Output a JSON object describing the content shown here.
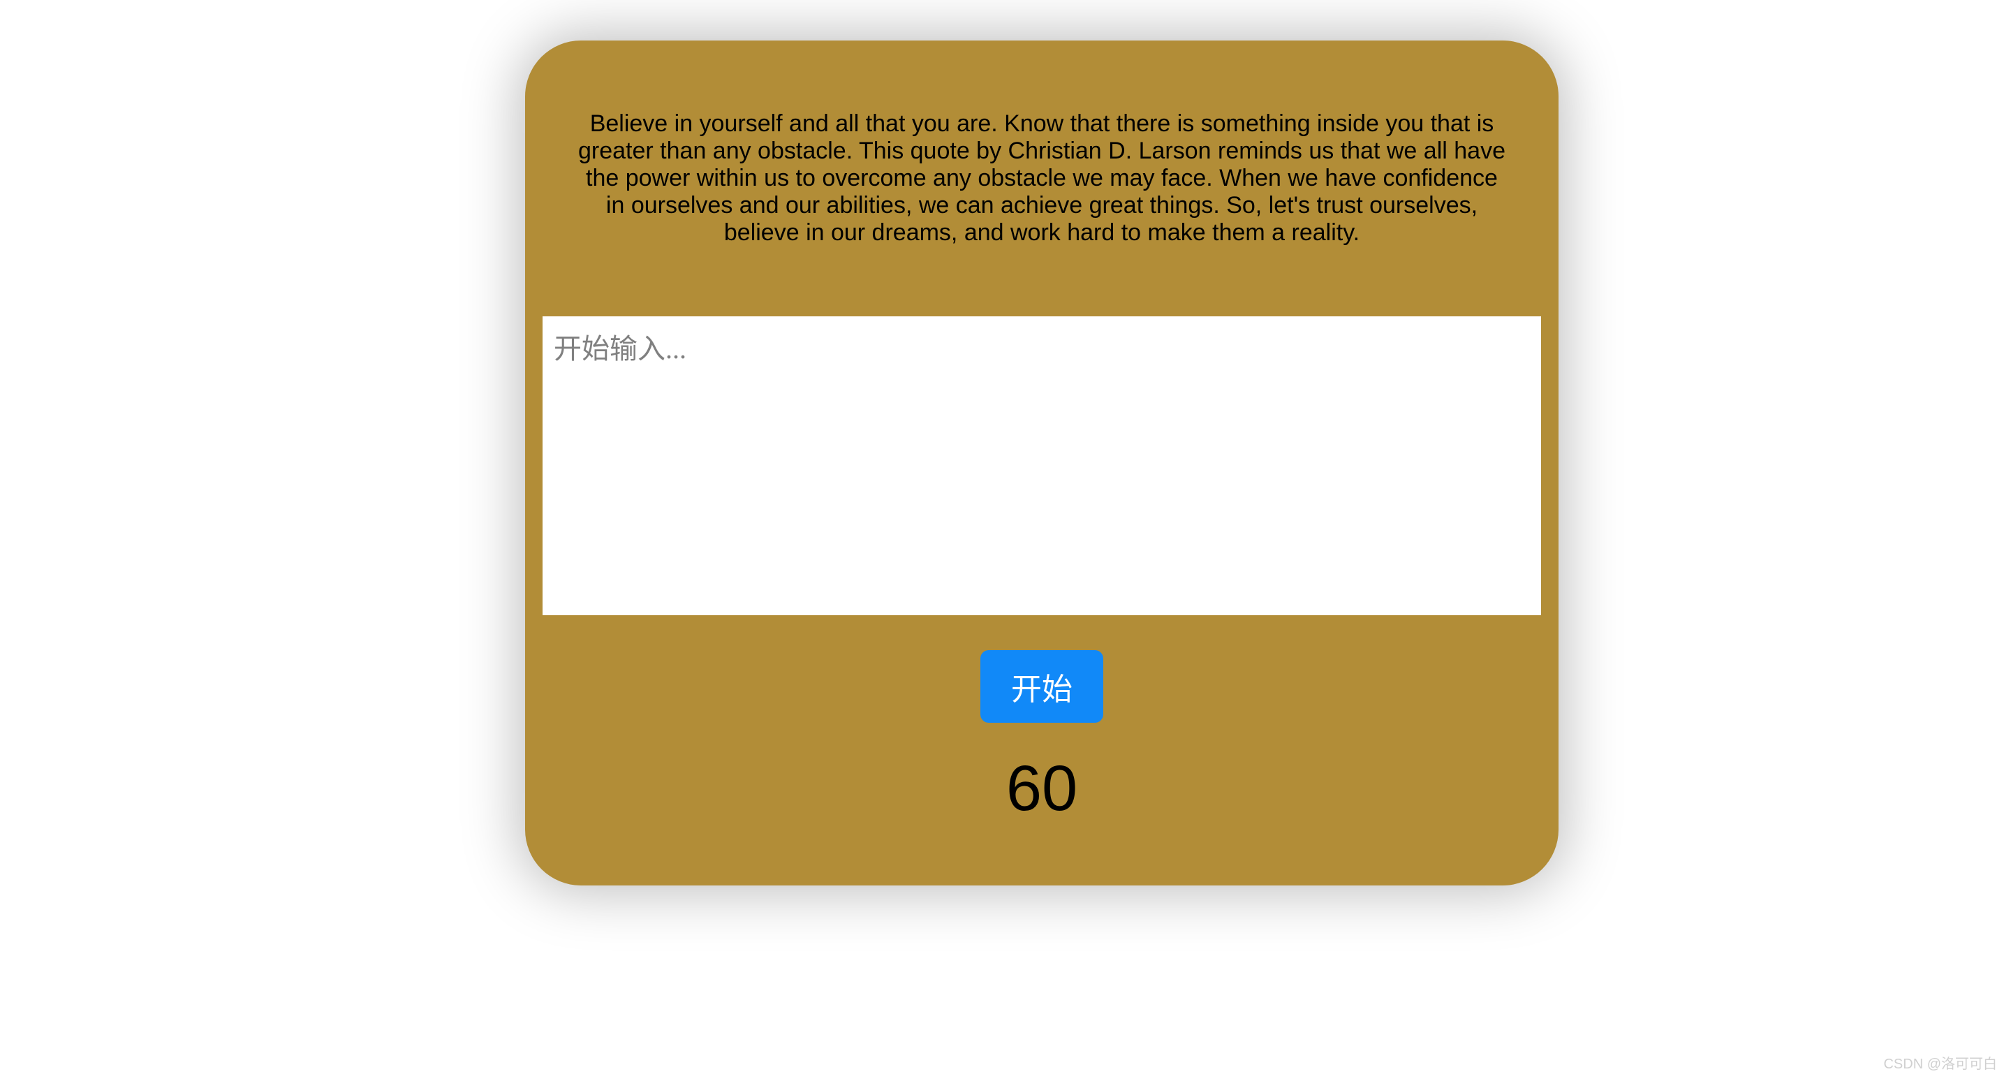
{
  "card": {
    "quote": "Believe in yourself and all that you are. Know that there is something inside you that is greater than any obstacle. This quote by Christian D. Larson reminds us that we all have the power within us to overcome any obstacle we may face. When we have confidence in ourselves and our abilities, we can achieve great things. So, let's trust ourselves, believe in our dreams, and work hard to make them a reality.",
    "input": {
      "placeholder": "开始输入...",
      "value": ""
    },
    "start_button_label": "开始",
    "timer_value": "60"
  },
  "watermark": "CSDN @洛可可白"
}
